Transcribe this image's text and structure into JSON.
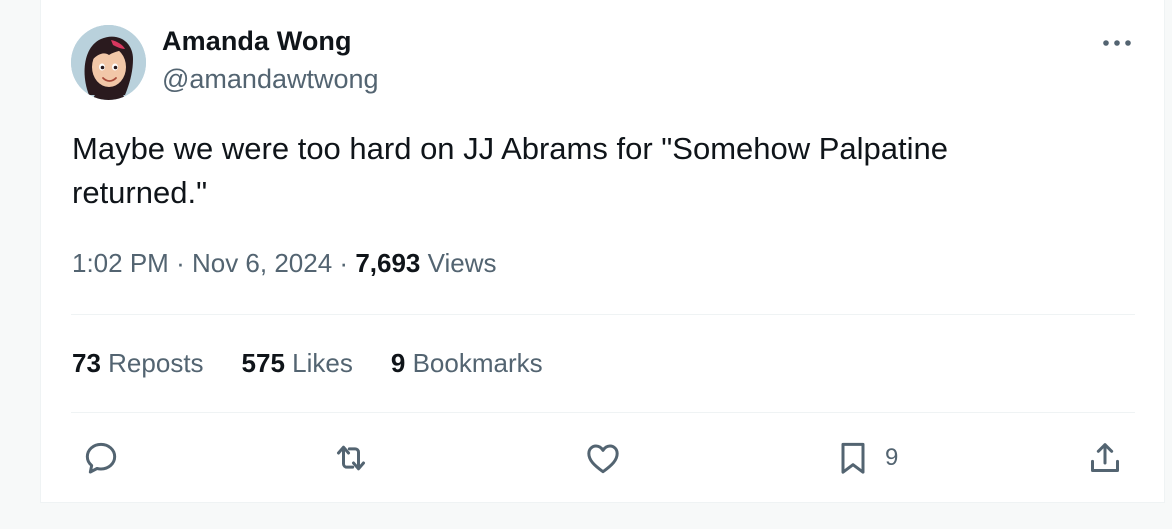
{
  "author": {
    "display_name": "Amanda Wong",
    "handle": "@amandawtwong"
  },
  "tweet": {
    "text": "Maybe we were too hard on JJ Abrams for \"Somehow Palpatine returned.\""
  },
  "meta": {
    "time": "1:02 PM",
    "separator": "·",
    "date": "Nov 6, 2024",
    "views_count": "7,693",
    "views_label": "Views"
  },
  "stats": {
    "reposts_count": "73",
    "reposts_label": "Reposts",
    "likes_count": "575",
    "likes_label": "Likes",
    "bookmarks_count": "9",
    "bookmarks_label": "Bookmarks"
  },
  "actions": {
    "bookmark_count": "9"
  },
  "icons": {
    "more": "more-horizontal-icon",
    "reply": "reply-icon",
    "repost": "repost-icon",
    "like": "heart-icon",
    "bookmark": "bookmark-icon",
    "share": "share-icon"
  },
  "colors": {
    "text_primary": "#0f1419",
    "text_secondary": "#536471",
    "divider": "#eff3f4"
  }
}
